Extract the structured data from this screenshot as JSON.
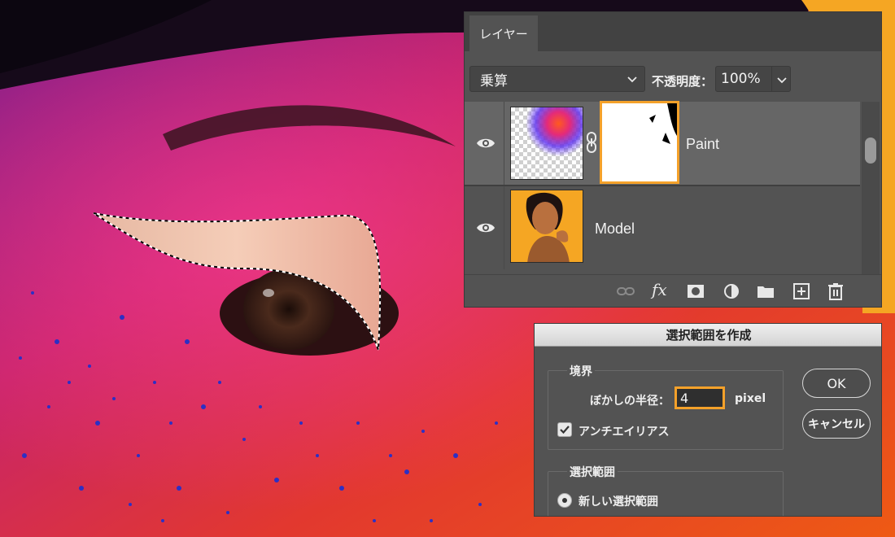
{
  "layers_panel": {
    "tab_label": "レイヤー",
    "blend_mode": "乗算",
    "opacity_label": "不透明度：",
    "opacity_value": "100%",
    "layers": [
      {
        "name": "Paint",
        "selected": true,
        "has_mask": true
      },
      {
        "name": "Model",
        "selected": false,
        "has_mask": false
      }
    ],
    "footer_icons": [
      "link-icon",
      "fx-icon",
      "add-mask-icon",
      "adjustment-icon",
      "folder-icon",
      "new-layer-icon",
      "trash-icon"
    ],
    "fx_label": "fx"
  },
  "dialog": {
    "title": "選択範囲を作成",
    "border_group": {
      "title": "境界",
      "feather_label": "ぼかしの半径：",
      "feather_value": "4",
      "unit": "pixel",
      "antialias_label": "アンチエイリアス",
      "antialias_checked": true
    },
    "selection_group": {
      "title": "選択範囲",
      "option_new": "新しい選択範囲",
      "option_new_selected": true
    },
    "ok_label": "OK",
    "cancel_label": "キャンセル"
  },
  "colors": {
    "accent": "#f4a12a",
    "panel_bg": "#535353",
    "selected_row": "#666666"
  }
}
